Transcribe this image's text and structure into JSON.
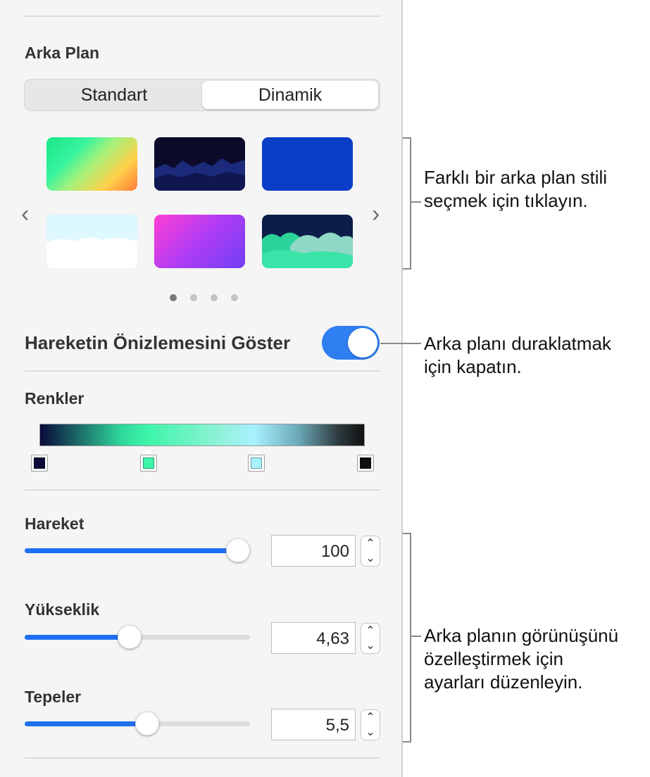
{
  "background_section": {
    "title": "Arka Plan",
    "segments": [
      {
        "label": "Standart",
        "selected": false
      },
      {
        "label": "Dinamik",
        "selected": true
      }
    ],
    "thumbnails": [
      {
        "name": "rainbow-gradient"
      },
      {
        "name": "dark-mountains"
      },
      {
        "name": "solid-blue"
      },
      {
        "name": "light-clouds"
      },
      {
        "name": "purple-pink-gradient"
      },
      {
        "name": "teal-clouds"
      }
    ],
    "nav_prev_icon": "chevron-left-icon",
    "nav_next_icon": "chevron-right-icon",
    "page_count": 4,
    "current_page": 1
  },
  "motion_preview": {
    "label": "Hareketin Önizlemesini Göster",
    "enabled": true
  },
  "colors_section": {
    "title": "Renkler",
    "stops": [
      {
        "color": "#0a0a3a"
      },
      {
        "color": "#3cf5a9"
      },
      {
        "color": "#a8f1ff"
      },
      {
        "color": "#111111"
      }
    ]
  },
  "sliders": {
    "motion": {
      "label": "Hareket",
      "value": "100",
      "fraction": 1.0
    },
    "height": {
      "label": "Yükseklik",
      "value": "4,63",
      "fraction": 0.46
    },
    "peaks": {
      "label": "Tepeler",
      "value": "5,5",
      "fraction": 0.55
    }
  },
  "callouts": {
    "style": [
      "Farklı bir arka plan stili",
      "seçmek için tıklayın."
    ],
    "pause": [
      "Arka planı duraklatmak",
      "için kapatın."
    ],
    "customize": [
      "Arka planın görünüşünü",
      "özelleştirmek için",
      "ayarları düzenleyin."
    ]
  },
  "colors": {
    "accent": "#1e6ff1",
    "panel_bg": "#f5f5f5"
  }
}
